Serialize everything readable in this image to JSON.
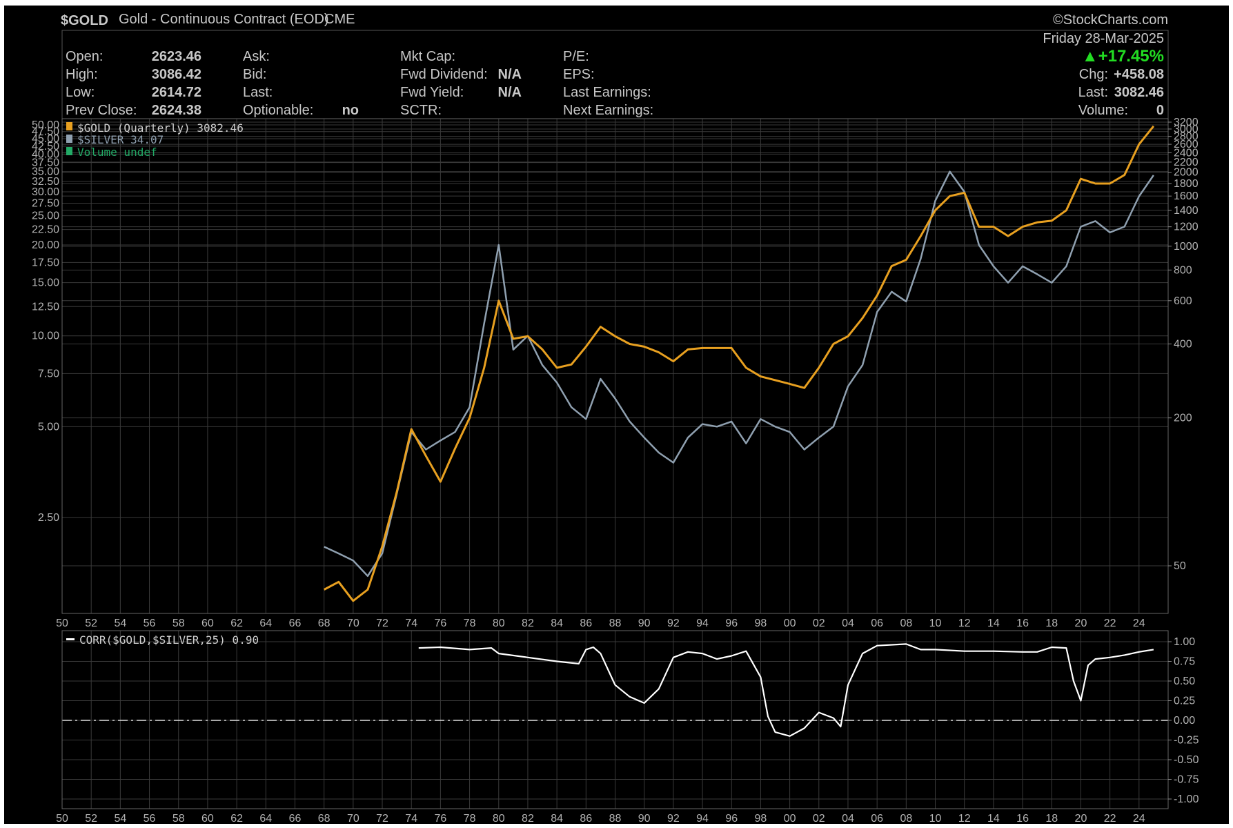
{
  "header": {
    "symbol": "$GOLD",
    "name": "Gold - Continuous Contract (EOD)",
    "exchange": "CME",
    "watermark": "©StockCharts.com",
    "date": "Friday  28-Mar-2025",
    "change_pct": "▲+17.45%",
    "chg_label": "Chg:",
    "chg_value": "+458.08",
    "last_label": "Last:",
    "last_value": "3082.46",
    "volume_label": "Volume:",
    "volume_value": "0"
  },
  "quote": {
    "open_label": "Open:",
    "open_value": "2623.46",
    "high_label": "High:",
    "high_value": "3086.42",
    "low_label": "Low:",
    "low_value": "2614.72",
    "prev_label": "Prev Close:",
    "prev_value": "2624.38",
    "ask_label": "Ask:",
    "bid_label": "Bid:",
    "last_label": "Last:",
    "optionable_label": "Optionable:",
    "optionable_value": "no",
    "mktcap_label": "Mkt Cap:",
    "fwd_div_label": "Fwd Dividend:",
    "fwd_div_value": "N/A",
    "fwd_yield_label": "Fwd Yield:",
    "fwd_yield_value": "N/A",
    "sctr_label": "SCTR:",
    "pe_label": "P/E:",
    "eps_label": "EPS:",
    "last_earn_label": "Last Earnings:",
    "next_earn_label": "Next Earnings:"
  },
  "legend": {
    "gold": "$GOLD (Quarterly) 3082.46",
    "silver": "$SILVER 34.07",
    "volume": "Volume undef",
    "corr": "CORR($GOLD,$SILVER,25) 0.90"
  },
  "colors": {
    "background": "#000000",
    "gold": "#e8a020",
    "silver": "#8fa0b0",
    "corr": "#ffffff",
    "grid": "#3a3a3a",
    "up": "#22dd22"
  },
  "chart_data": [
    {
      "type": "line",
      "title": "$GOLD (Quarterly) 3082.46",
      "x_ticks": [
        "50",
        "52",
        "54",
        "56",
        "58",
        "60",
        "62",
        "64",
        "66",
        "68",
        "70",
        "72",
        "74",
        "76",
        "78",
        "80",
        "82",
        "84",
        "86",
        "88",
        "90",
        "92",
        "94",
        "96",
        "98",
        "00",
        "02",
        "04",
        "06",
        "08",
        "10",
        "12",
        "14",
        "16",
        "18",
        "20",
        "22",
        "24"
      ],
      "y_right_scale": "log",
      "y_right_ticks": [
        "3200",
        "3000",
        "2800",
        "2600",
        "2400",
        "2200",
        "2000",
        "1800",
        "1600",
        "1400",
        "1200",
        "1000",
        "800",
        "600",
        "400",
        "200",
        "50"
      ],
      "y_left_scale": "log",
      "y_left_ticks": [
        "50.00",
        "47.50",
        "45.00",
        "42.50",
        "40.00",
        "37.50",
        "35.00",
        "32.50",
        "30.00",
        "27.50",
        "25.00",
        "22.50",
        "20.00",
        "17.50",
        "15.00",
        "12.50",
        "10.00",
        "7.50",
        "5.00",
        "2.50"
      ],
      "series": [
        {
          "name": "$GOLD",
          "axis": "right",
          "x": [
            1968,
            1969,
            1970,
            1971,
            1972,
            1973,
            1974,
            1975,
            1976,
            1977,
            1978,
            1979,
            1980,
            1981,
            1982,
            1983,
            1984,
            1985,
            1986,
            1987,
            1988,
            1989,
            1990,
            1991,
            1992,
            1993,
            1994,
            1995,
            1996,
            1997,
            1998,
            1999,
            2000,
            2001,
            2002,
            2003,
            2004,
            2005,
            2006,
            2007,
            2008,
            2009,
            2010,
            2011,
            2012,
            2013,
            2014,
            2015,
            2016,
            2017,
            2018,
            2019,
            2020,
            2021,
            2022,
            2023,
            2024,
            2025
          ],
          "values": [
            40,
            43,
            36,
            40,
            60,
            100,
            180,
            140,
            110,
            150,
            200,
            320,
            600,
            420,
            430,
            380,
            320,
            330,
            390,
            470,
            430,
            400,
            390,
            370,
            340,
            380,
            385,
            385,
            385,
            320,
            295,
            285,
            275,
            265,
            320,
            400,
            430,
            510,
            630,
            830,
            880,
            1100,
            1400,
            1600,
            1650,
            1200,
            1200,
            1100,
            1200,
            1250,
            1270,
            1400,
            1880,
            1800,
            1800,
            1950,
            2600,
            3082
          ]
        },
        {
          "name": "$SILVER",
          "axis": "left",
          "x": [
            1968,
            1969,
            1970,
            1971,
            1972,
            1973,
            1974,
            1975,
            1976,
            1977,
            1978,
            1979,
            1980,
            1981,
            1982,
            1983,
            1984,
            1985,
            1986,
            1987,
            1988,
            1989,
            1990,
            1991,
            1992,
            1993,
            1994,
            1995,
            1996,
            1997,
            1998,
            1999,
            2000,
            2001,
            2002,
            2003,
            2004,
            2005,
            2006,
            2007,
            2008,
            2009,
            2010,
            2011,
            2012,
            2013,
            2014,
            2015,
            2016,
            2017,
            2018,
            2019,
            2020,
            2021,
            2022,
            2023,
            2024,
            2025
          ],
          "values": [
            2.0,
            1.9,
            1.8,
            1.6,
            1.9,
            3.0,
            4.8,
            4.2,
            4.5,
            4.8,
            5.8,
            11,
            20,
            9,
            10,
            8,
            7,
            5.8,
            5.3,
            7.2,
            6.2,
            5.2,
            4.6,
            4.1,
            3.8,
            4.6,
            5.1,
            5.0,
            5.2,
            4.4,
            5.3,
            5.0,
            4.8,
            4.2,
            4.6,
            5.0,
            6.8,
            8,
            12,
            14,
            13,
            18,
            28,
            35,
            30,
            20,
            17,
            15,
            17,
            16,
            15,
            17,
            23,
            24,
            22,
            23,
            29,
            34.07
          ]
        }
      ]
    },
    {
      "type": "line",
      "title": "CORR($GOLD,$SILVER,25) 0.90",
      "x_ticks": [
        "50",
        "52",
        "54",
        "56",
        "58",
        "60",
        "62",
        "64",
        "66",
        "68",
        "70",
        "72",
        "74",
        "76",
        "78",
        "80",
        "82",
        "84",
        "86",
        "88",
        "90",
        "92",
        "94",
        "96",
        "98",
        "00",
        "02",
        "04",
        "06",
        "08",
        "10",
        "12",
        "14",
        "16",
        "18",
        "20",
        "22",
        "24"
      ],
      "y_ticks": [
        "1.00",
        "0.75",
        "0.50",
        "0.25",
        "0.00",
        "-0.25",
        "-0.50",
        "-0.75",
        "-1.00"
      ],
      "ylim": [
        -1,
        1
      ],
      "reference_line": 0,
      "series": [
        {
          "name": "CORR($GOLD,$SILVER,25)",
          "x": [
            1974.5,
            1976,
            1978,
            1979.5,
            1980,
            1982,
            1984,
            1985.5,
            1986,
            1986.5,
            1987,
            1988,
            1989,
            1990,
            1991,
            1992,
            1993,
            1994,
            1995,
            1996,
            1997,
            1998,
            1998.5,
            1999,
            2000,
            2001,
            2002,
            2003,
            2003.5,
            2004,
            2005,
            2006,
            2008,
            2009,
            2010,
            2012,
            2014,
            2016,
            2017,
            2018,
            2019,
            2019.5,
            2020,
            2020.5,
            2021,
            2022,
            2023,
            2024,
            2025
          ],
          "values": [
            0.92,
            0.93,
            0.9,
            0.92,
            0.85,
            0.8,
            0.75,
            0.72,
            0.9,
            0.93,
            0.85,
            0.45,
            0.3,
            0.22,
            0.4,
            0.8,
            0.87,
            0.85,
            0.78,
            0.82,
            0.88,
            0.55,
            0.05,
            -0.15,
            -0.2,
            -0.1,
            0.1,
            0.03,
            -0.08,
            0.45,
            0.85,
            0.95,
            0.97,
            0.9,
            0.9,
            0.88,
            0.88,
            0.87,
            0.87,
            0.93,
            0.92,
            0.5,
            0.25,
            0.7,
            0.78,
            0.8,
            0.83,
            0.87,
            0.9
          ]
        }
      ]
    }
  ]
}
